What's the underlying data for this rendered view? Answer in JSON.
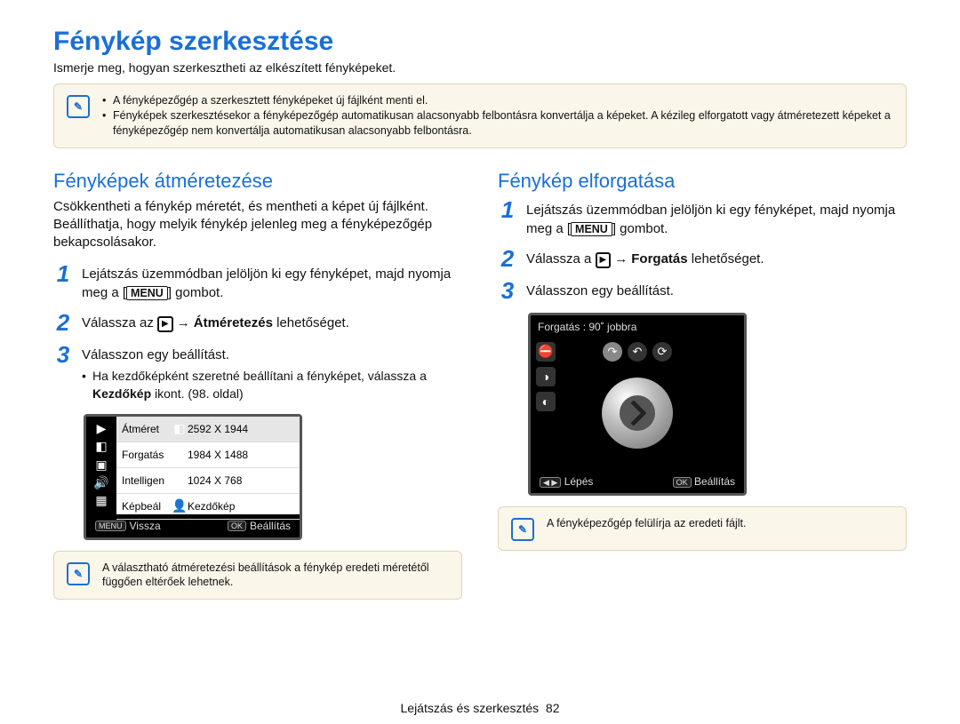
{
  "title": "Fénykép szerkesztése",
  "intro": "Ismerje meg, hogyan szerkesztheti az elkészített fényképeket.",
  "top_notes": [
    "A fényképezőgép a szerkesztett fényképeket új fájlként menti el.",
    "Fényképek szerkesztésekor a fényképezőgép automatikusan alacsonyabb felbontásra konvertálja a képeket. A kézileg elforgatott vagy átméretezett képeket a fényképezőgép nem konvertálja automatikusan alacsonyabb felbontásra."
  ],
  "left": {
    "h": "Fényképek átméretezése",
    "p": "Csökkentheti a fénykép méretét, és mentheti a képet új fájlként. Beállíthatja, hogy melyik fénykép jelenleg meg a fényképezőgép bekapcsolásakor.",
    "steps": [
      {
        "n": "1",
        "pre": "Lejátszás üzemmódban jelöljön ki egy fényképet, majd nyomja meg a ",
        "btn": "MENU",
        "post": " gombot."
      },
      {
        "n": "2",
        "pre": "Válassza az ",
        "icon": "▶",
        "arrow": "→",
        "strong": "Átméretezés",
        "post": " lehetőséget."
      },
      {
        "n": "3",
        "pre": "Válasszon egy beállítást.",
        "sub": {
          "pre": "Ha kezdőképként szeretné beállítani a fényképet, válassza a ",
          "strong": "Kezdőkép",
          "post": " ikont. (98. oldal)"
        }
      }
    ],
    "screen": {
      "side_icons": [
        "▶",
        "◧",
        "▣",
        "🔊",
        "▦"
      ],
      "rows": [
        {
          "lbl": "Átméret",
          "val": "2592 X 1944",
          "sel": true
        },
        {
          "lbl": "Forgatás",
          "val": "1984 X 1488"
        },
        {
          "lbl": "Intelligen",
          "val": "1024 X 768"
        },
        {
          "lbl": "Képbeál",
          "val": "Kezdőkép"
        }
      ],
      "back_btn": "MENU",
      "back_lbl": "Vissza",
      "ok_btn": "OK",
      "ok_lbl": "Beállítás"
    },
    "note": "A választható átméretezési beállítások a fénykép eredeti méretétől függően eltérőek lehetnek."
  },
  "right": {
    "h": "Fénykép elforgatása",
    "steps": [
      {
        "n": "1",
        "pre": "Lejátszás üzemmódban jelöljön ki egy fényképet, majd nyomja meg a ",
        "btn": "MENU",
        "post": " gombot."
      },
      {
        "n": "2",
        "pre": "Válassza a ",
        "icon": "▶",
        "arrow": "→",
        "strong": "Forgatás",
        "post": " lehetőséget."
      },
      {
        "n": "3",
        "pre": "Válasszon egy beállítást."
      }
    ],
    "screen": {
      "head": "Forgatás   : 90˚ jobbra",
      "step_btn": "◀ ▶",
      "step_lbl": "Lépés",
      "ok_btn": "OK",
      "ok_lbl": "Beállítás"
    },
    "note": "A fényképezőgép felülírja az eredeti fájlt."
  },
  "footer": {
    "section": "Lejátszás és szerkesztés",
    "page": "82"
  }
}
